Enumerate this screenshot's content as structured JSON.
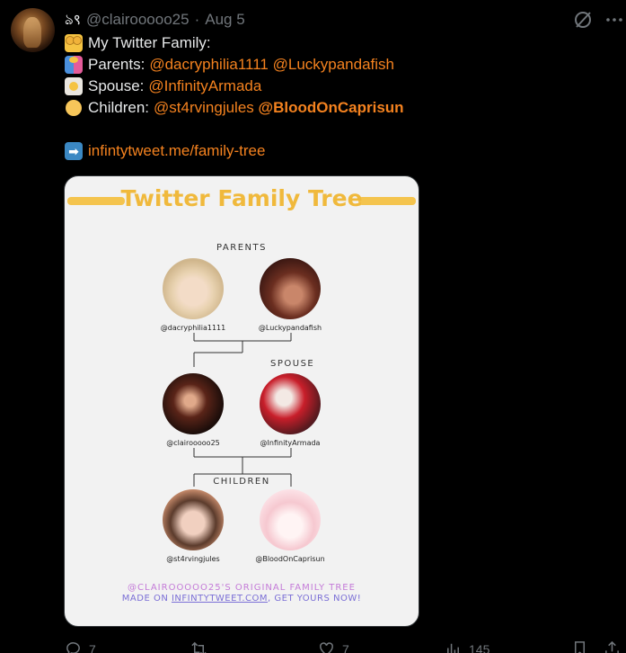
{
  "tweet": {
    "author_glyph": "ঌ९",
    "handle": "@clairooooo25",
    "separator": "·",
    "date": "Aug 5",
    "lines": {
      "title": "My Twitter Family:",
      "parents_label": "Parents:",
      "parents": [
        "@dacryphilia1111",
        "@Luckypandafish"
      ],
      "spouse_label": "Spouse:",
      "spouse": "@InfinityArmada",
      "children_label": "Children:",
      "children": [
        "@st4rvingjules",
        "@BloodOnCaprisun"
      ],
      "link": "infintytweet.me/family-tree"
    },
    "emoji": [
      "family-emoji",
      "couple-emoji",
      "bride-emoji",
      "baby-emoji",
      "right-arrow-emoji"
    ]
  },
  "card": {
    "title": "Twitter Family Tree",
    "parents_heading": "PARENTS",
    "spouse_heading": "SPOUSE",
    "children_heading": "CHILDREN",
    "people": {
      "parent1": "@dacryphilia1111",
      "parent2": "@Luckypandafish",
      "self": "@clairooooo25",
      "spouse": "@InfinityArmada",
      "child1": "@st4rvingjules",
      "child2": "@BloodOnCaprisun"
    },
    "footer_line1": "@CLAIROOOOO25'S ORIGINAL FAMILY TREE",
    "footer_made_on": "MADE ON ",
    "footer_site": "INFINTYTWEET.COM",
    "footer_tail": ", GET YOURS NOW!",
    "colors": {
      "title": "#f0b93c",
      "bars": "#f4c44e",
      "footer1": "#c47bd8",
      "footer2": "#7b6fd6"
    }
  },
  "actions": {
    "replies": "7",
    "retweets": "",
    "likes": "7",
    "views": "145"
  },
  "colors": {
    "background": "#000000",
    "text": "#e7e9ea",
    "muted": "#71767b",
    "accent": "#f4821f"
  },
  "icons": [
    "grok-icon",
    "more-icon",
    "reply-icon",
    "retweet-icon",
    "like-icon",
    "views-icon",
    "bookmark-icon",
    "share-icon"
  ]
}
